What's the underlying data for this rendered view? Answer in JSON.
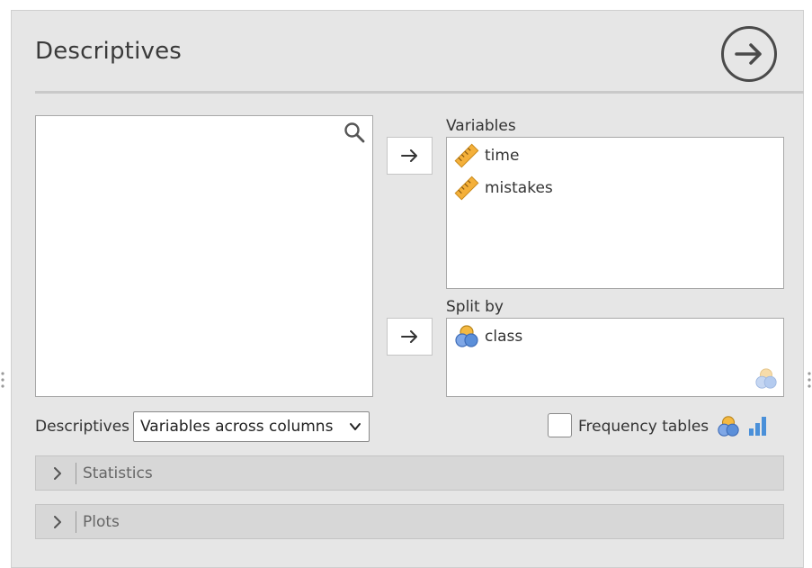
{
  "header": {
    "title": "Descriptives",
    "run_icon": "arrow-right-circle-icon"
  },
  "source": {
    "search_icon": "search-icon"
  },
  "variables": {
    "label": "Variables",
    "move_icon": "arrow-right-icon",
    "items": [
      {
        "label": "time",
        "icon": "ruler-continuous-icon"
      },
      {
        "label": "mistakes",
        "icon": "ruler-continuous-icon"
      }
    ]
  },
  "split_by": {
    "label": "Split by",
    "move_icon": "arrow-right-icon",
    "items": [
      {
        "label": "class",
        "icon": "nominal-circles-icon"
      }
    ],
    "placeholder_icon": "nominal-circles-faded-icon"
  },
  "options": {
    "descriptives_label": "Descriptives",
    "descriptives_value": "Variables across columns",
    "frequency_tables_label": "Frequency tables",
    "frequency_tables_checked": false
  },
  "sections": [
    {
      "label": "Statistics"
    },
    {
      "label": "Plots"
    }
  ],
  "colors": {
    "panel_bg": "#e6e6e6",
    "ruler": "#f0a830",
    "nominal_orange": "#f4b942",
    "nominal_blue": "#5b8fd9",
    "bar_blue": "#4a90d9"
  }
}
